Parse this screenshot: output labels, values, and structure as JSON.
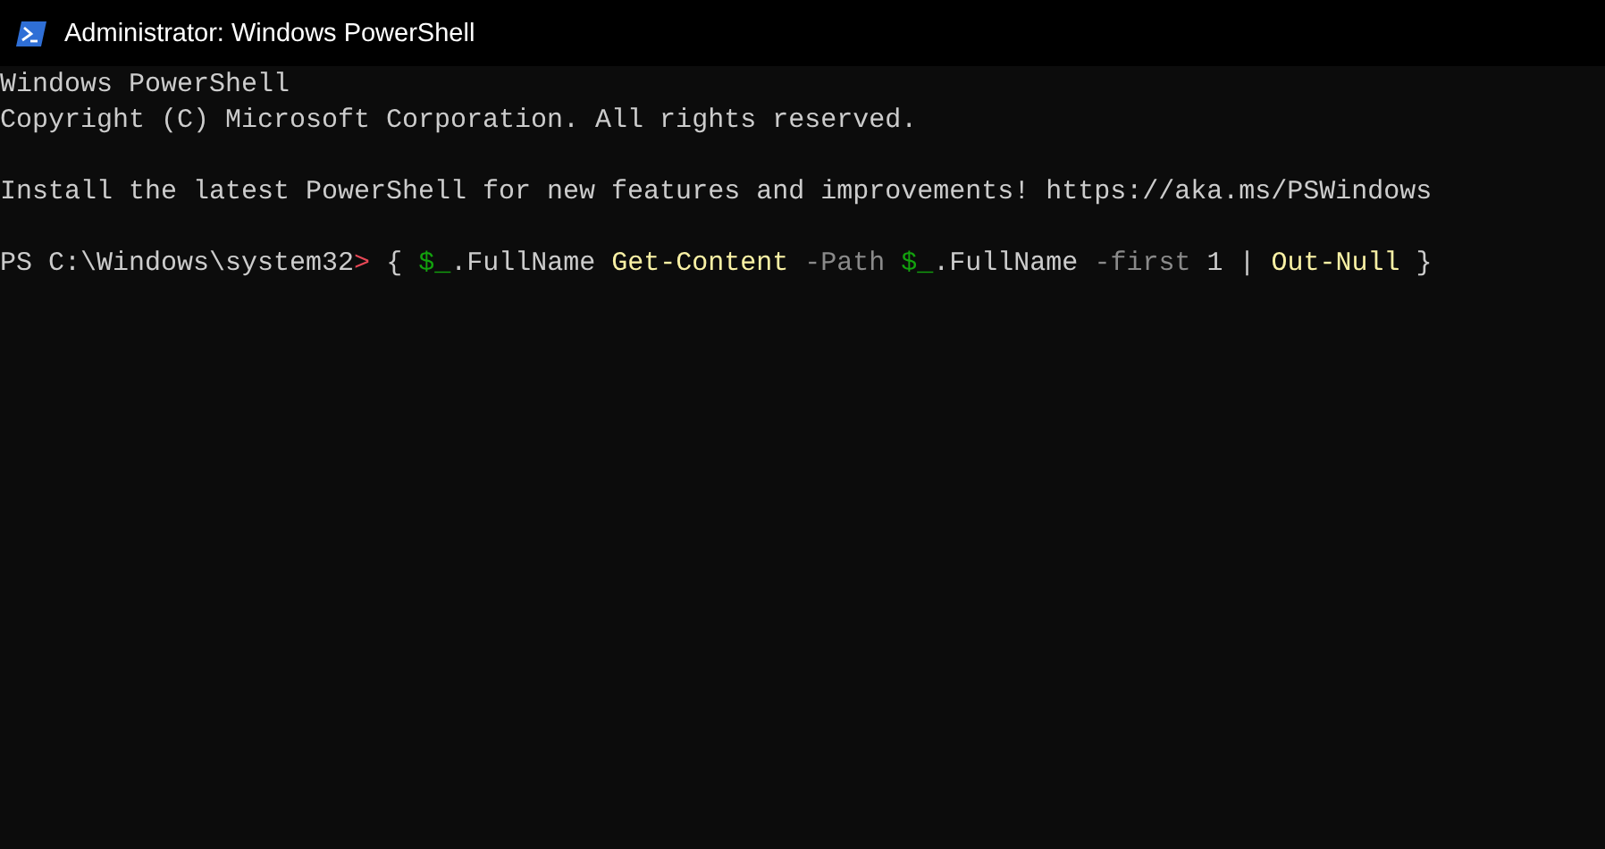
{
  "window": {
    "title": "Administrator: Windows PowerShell"
  },
  "console": {
    "lines": [
      {
        "tokens": [
          {
            "kind": "output",
            "text": "Windows PowerShell"
          }
        ]
      },
      {
        "tokens": [
          {
            "kind": "output",
            "text": "Copyright (C) Microsoft Corporation. All rights reserved."
          }
        ]
      },
      {
        "kind": "blank"
      },
      {
        "tokens": [
          {
            "kind": "output",
            "text": "Install the latest PowerShell for new features and improvements! https://aka.ms/PSWindows"
          }
        ]
      },
      {
        "kind": "blank"
      },
      {
        "tokens": [
          {
            "kind": "output",
            "text": "PS C:\\Windows\\system32"
          },
          {
            "kind": "prompt",
            "text": ">"
          },
          {
            "kind": "output",
            "text": " { "
          },
          {
            "kind": "variable",
            "text": "$_"
          },
          {
            "kind": "output",
            "text": ".FullName "
          },
          {
            "kind": "command",
            "text": "Get-Content"
          },
          {
            "kind": "parameter",
            "text": " -Path "
          },
          {
            "kind": "variable",
            "text": "$_"
          },
          {
            "kind": "output",
            "text": ".FullName "
          },
          {
            "kind": "parameter",
            "text": "-first "
          },
          {
            "kind": "output",
            "text": "1 | "
          },
          {
            "kind": "command",
            "text": "Out-Null"
          },
          {
            "kind": "output",
            "text": " }"
          }
        ]
      }
    ]
  }
}
